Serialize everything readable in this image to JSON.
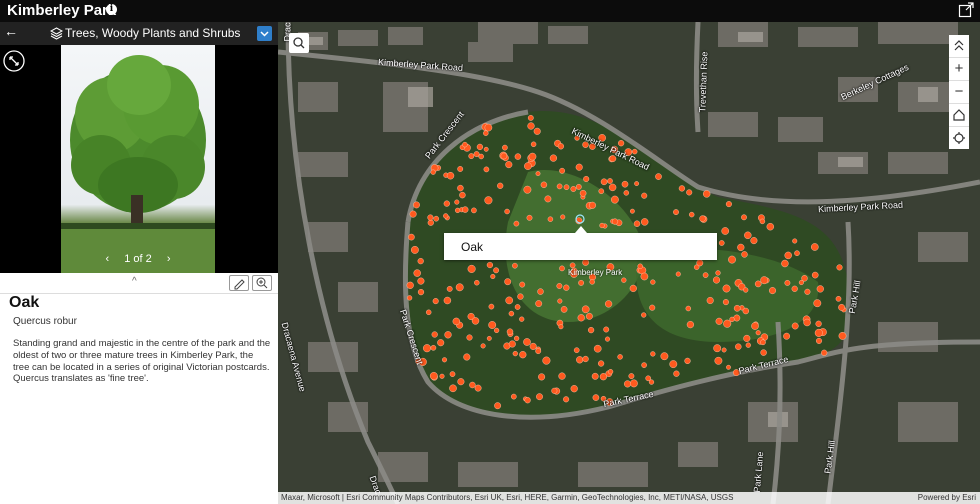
{
  "app": {
    "title": "Kimberley Park"
  },
  "panel": {
    "layer_title": "Trees, Woody Plants and Shrubs",
    "pager_prev": "‹",
    "pager_text": "1 of 2",
    "pager_next": "›",
    "feature": {
      "title": "Oak",
      "subtitle": "Quercus robur",
      "description": "Standing grand and majestic in the centre of the park and the oldest of two or three mature trees in Kimberley Park, the tree can be located in a series of original Victorian postcards. Quercus translates as 'fine tree'."
    }
  },
  "map": {
    "popup_text": "Oak",
    "park_label": "Kimberley Park",
    "streets": {
      "kimberley_park_road_top": "Kimberley Park Road",
      "kimberley_park_road_mid": "Kimberley Park Road",
      "kimberley_park_road_right": "Kimberley Park Road",
      "park_crescent_top": "Park Crescent",
      "park_crescent_left": "Park Crescent",
      "park_terrace_low": "Park Terrace",
      "park_terrace_right": "Park Terrace",
      "park_hill": "Park Hill",
      "park_hill_low": "Park Hill",
      "trevethan_rise": "Trevethan Rise",
      "berkeley_cottages": "Berkeley Cottages",
      "dracaena_avenue": "Dracaena Avenue",
      "park_lane": "Park Lane",
      "dracaena_top": "Drac",
      "dracaena_bottom": "Drac"
    },
    "attribution": "Maxar, Microsoft | Esri Community Maps Contributors, Esri UK, Esri, HERE, Garmin, GeoTechnologies, Inc, METI/NASA, USGS",
    "powered_by": "Powered by Esri",
    "zoom_in": "+",
    "zoom_out": "−",
    "colors": {
      "tree_marker": "#ff5a1f",
      "park_green": "#3b5a2a",
      "road": "#8b8b86"
    }
  },
  "icons": [
    "info-icon",
    "share-icon",
    "back-arrow-icon",
    "layers-icon",
    "chevron-down-icon",
    "expand-icon",
    "collapse-icon",
    "edit-icon",
    "zoom-to-icon",
    "search-icon",
    "collapse-up-icon",
    "home-icon",
    "locate-icon"
  ]
}
